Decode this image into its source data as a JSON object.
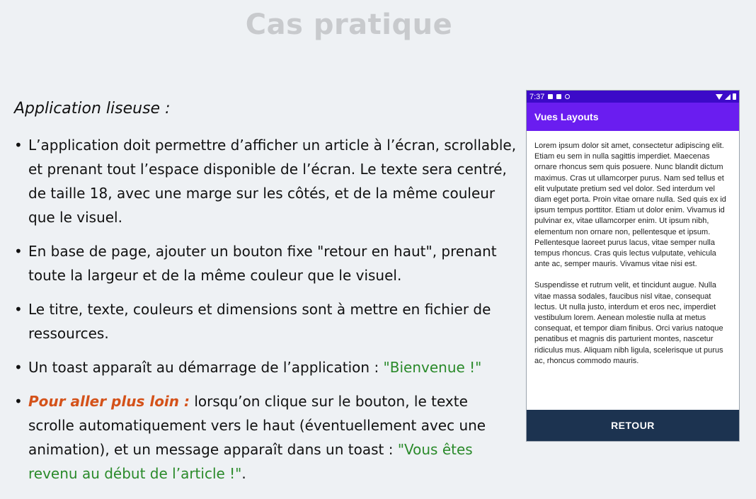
{
  "slide": {
    "title": "Cas pratique",
    "intro": "Application liseuse :",
    "bullets": [
      {
        "text": "L’application doit permettre d’afficher un article à l’écran, scrollable, et prenant tout l’espace disponible de l’écran. Le texte sera centré, de taille 18, avec une marge sur les côtés, et de la même couleur que le visuel."
      },
      {
        "text": "En base de page, ajouter un bouton fixe \"retour en haut\", prenant toute la largeur et de la même couleur que le visuel."
      },
      {
        "text": "Le titre, texte, couleurs et dimensions sont à mettre en fichier de ressources."
      },
      {
        "text": "Un toast apparaît au démarrage de l’application : ",
        "green": "\"Bienvenue !\""
      },
      {
        "highlight": "Pour aller plus loin :",
        "text": " lorsqu’on clique sur le bouton, le texte scrolle automatiquement vers le haut (éventuellement avec une animation), et un message apparaît dans un toast : ",
        "green": "\"Vous êtes revenu au début de l’article !\"",
        "tail": "."
      }
    ]
  },
  "phone": {
    "status_time": "7:37",
    "status_icons": [
      "notification-icon",
      "sim-icon",
      "sync-icon"
    ],
    "status_right_icons": [
      "wifi-icon",
      "signal-icon",
      "battery-icon"
    ],
    "app_title": "Vues Layouts",
    "article_paragraphs": [
      "Lorem ipsum dolor sit amet, consectetur adipiscing elit. Etiam eu sem in nulla sagittis imperdiet. Maecenas ornare rhoncus sem quis posuere. Nunc blandit dictum maximus. Cras ut ullamcorper purus. Nam sed tellus et elit vulputate pretium sed vel dolor. Sed interdum vel diam eget porta. Proin vitae ornare nulla. Sed quis ex id ipsum tempus porttitor. Etiam ut dolor enim. Vivamus id pulvinar ex, vitae ullamcorper enim. Ut ipsum nibh, elementum non ornare non, pellentesque et ipsum. Pellentesque laoreet purus lacus, vitae semper nulla tempus rhoncus. Cras quis lectus vulputate, vehicula ante ac, semper mauris. Vivamus vitae nisi est.",
      "Suspendisse et rutrum velit, et tincidunt augue. Nulla vitae massa sodales, faucibus nisl vitae, consequat lectus. Ut nulla justo, interdum et eros nec, imperdiet vestibulum lorem. Aenean molestie nulla at metus consequat, et tempor diam finibus. Orci varius natoque penatibus et magnis dis parturient montes, nascetur ridiculus mus. Aliquam nibh ligula, scelerisque ut purus ac, rhoncus commodo mauris."
    ],
    "button_label": "RETOUR"
  },
  "colors": {
    "background": "#eef1f4",
    "title": "#c8cacd",
    "green": "#2a8a2a",
    "orange": "#d4521a",
    "status_bar": "#3c0ac8",
    "app_bar": "#6a1df0",
    "button": "#1c3350"
  }
}
